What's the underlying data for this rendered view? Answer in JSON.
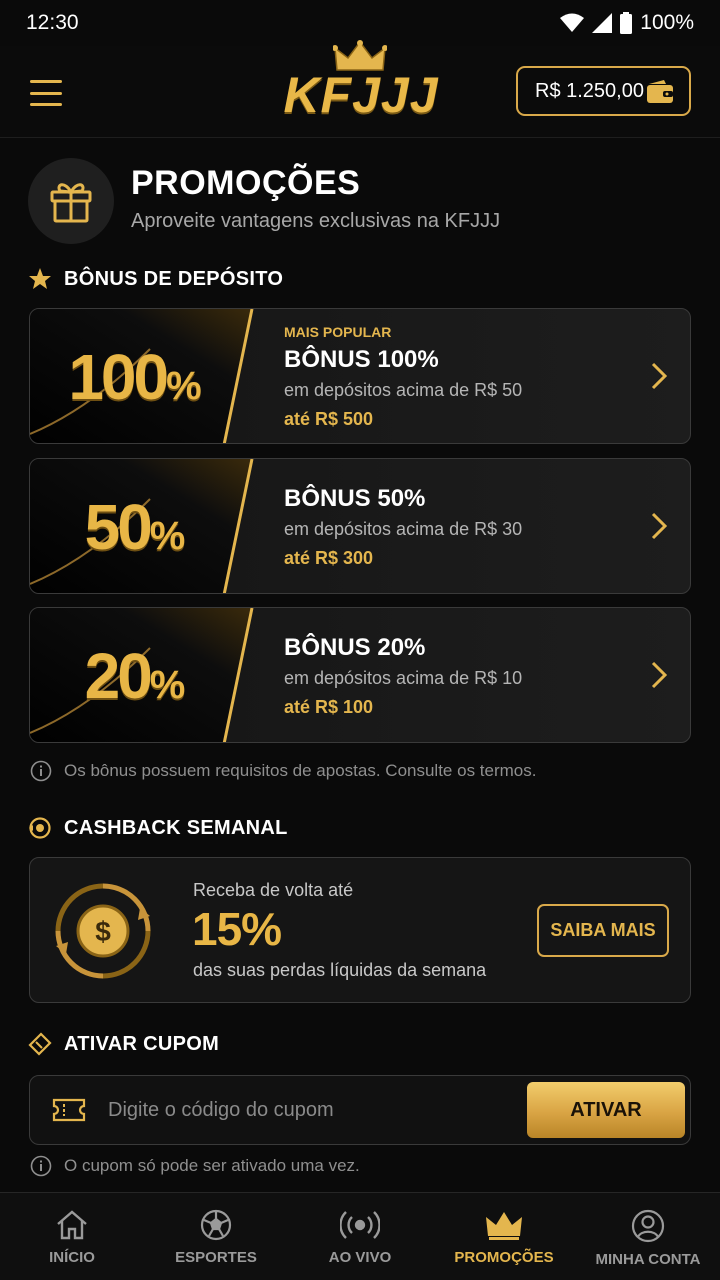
{
  "status_bar": {
    "time": "12:30",
    "battery": "100%"
  },
  "header": {
    "logo_text": "KFJJJ",
    "balance": "R$ 1.250,00"
  },
  "page": {
    "title": "PROMOÇÕES",
    "subtitle": "Aproveite vantagens exclusivas na KFJJJ"
  },
  "deposit_section": {
    "title": "BÔNUS DE DEPÓSITO",
    "cards": [
      {
        "percent": "100",
        "tag": "MAIS POPULAR",
        "name": "BÔNUS 100%",
        "desc": "em depósitos acima de R$ 50",
        "max": "até R$ 500"
      },
      {
        "percent": "50",
        "tag": "",
        "name": "BÔNUS 50%",
        "desc": "em depósitos acima de R$ 30",
        "max": "até R$ 300"
      },
      {
        "percent": "20",
        "tag": "",
        "name": "BÔNUS 20%",
        "desc": "em depósitos acima de R$ 10",
        "max": "até R$ 100"
      }
    ],
    "note": "Os bônus possuem requisitos de apostas. Consulte os termos."
  },
  "cashback_section": {
    "title": "CASHBACK SEMANAL",
    "line1": "Receba de volta até",
    "percent": "15%",
    "line2": "das suas perdas líquidas da semana",
    "button": "SAIBA MAIS"
  },
  "coupon_section": {
    "title": "ATIVAR CUPOM",
    "placeholder": "Digite o código do cupom",
    "button": "ATIVAR",
    "note": "O cupom só pode ser ativado uma vez."
  },
  "bottom_nav": [
    {
      "label": "INÍCIO",
      "icon": "home-icon",
      "active": false
    },
    {
      "label": "ESPORTES",
      "icon": "soccer-ball-icon",
      "active": false
    },
    {
      "label": "AO VIVO",
      "icon": "live-broadcast-icon",
      "active": false
    },
    {
      "label": "PROMOÇÕES",
      "icon": "crown-icon",
      "active": true
    },
    {
      "label": "MINHA CONTA",
      "icon": "user-icon",
      "active": false
    }
  ],
  "colors": {
    "accent": "#e4b64e",
    "background": "#0a0a0a",
    "card_border": "#3a3a3a"
  }
}
